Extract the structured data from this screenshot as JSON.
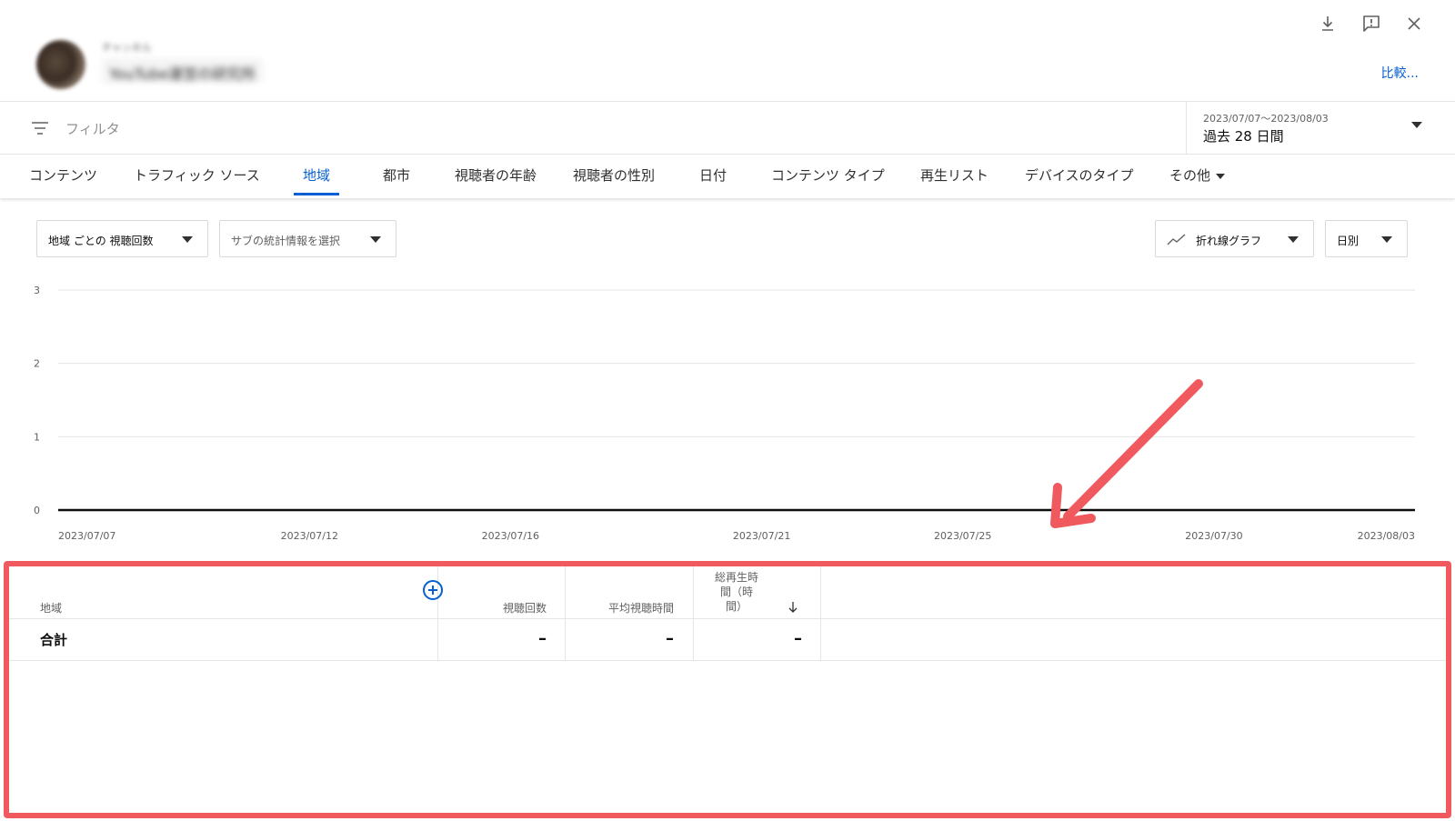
{
  "header": {
    "channel_subtitle": "チャンネル",
    "channel_name": "YouTube運営の研究所",
    "compare_label": "比較...",
    "icons": [
      "download-icon",
      "feedback-icon",
      "close-icon"
    ]
  },
  "filter_bar": {
    "filter_label": "フィルタ",
    "date_range": "2023/07/07〜2023/08/03",
    "date_label": "過去 28 日間"
  },
  "tabs": [
    {
      "label": "コンテンツ"
    },
    {
      "label": "トラフィック ソース"
    },
    {
      "label": "地域",
      "active": true
    },
    {
      "label": "都市"
    },
    {
      "label": "視聴者の年齢"
    },
    {
      "label": "視聴者の性別"
    },
    {
      "label": "日付"
    },
    {
      "label": "コンテンツ タイプ"
    },
    {
      "label": "再生リスト"
    },
    {
      "label": "デバイスのタイプ"
    },
    {
      "label": "その他"
    }
  ],
  "controls": {
    "metric_select": "地域 ごとの 視聴回数",
    "sub_metric_select": "サブの統計情報を選択",
    "chart_type_select": "折れ線グラフ",
    "interval_select": "日別"
  },
  "chart_data": {
    "type": "line",
    "title": "",
    "xlabel": "",
    "ylabel": "",
    "ylim": [
      0,
      3
    ],
    "y_ticks": [
      "0",
      "1",
      "2",
      "3"
    ],
    "x_tick_labels": [
      "2023/07/07",
      "2023/07/12",
      "2023/07/16",
      "2023/07/21",
      "2023/07/25",
      "2023/07/30",
      "2023/08/03"
    ],
    "x_range": [
      "2023/07/07",
      "2023/08/03"
    ],
    "series": [
      {
        "values": [
          0,
          0
        ]
      }
    ],
    "grid": true,
    "annotation": "red arrow pointing at the table below"
  },
  "table": {
    "columns": [
      {
        "label": "地域"
      },
      {
        "label": "視聴回数"
      },
      {
        "label": "平均視聴時間"
      },
      {
        "label_lines": [
          "総再生時",
          "間（時",
          "間）"
        ],
        "sorted": "desc"
      }
    ],
    "total_row": {
      "label": "合計",
      "values": [
        "–",
        "–",
        "–"
      ]
    }
  },
  "colors": {
    "accent": "#065fd4",
    "highlight_frame": "#f05a5f",
    "text": "#0d0d0d",
    "muted": "#606060"
  }
}
